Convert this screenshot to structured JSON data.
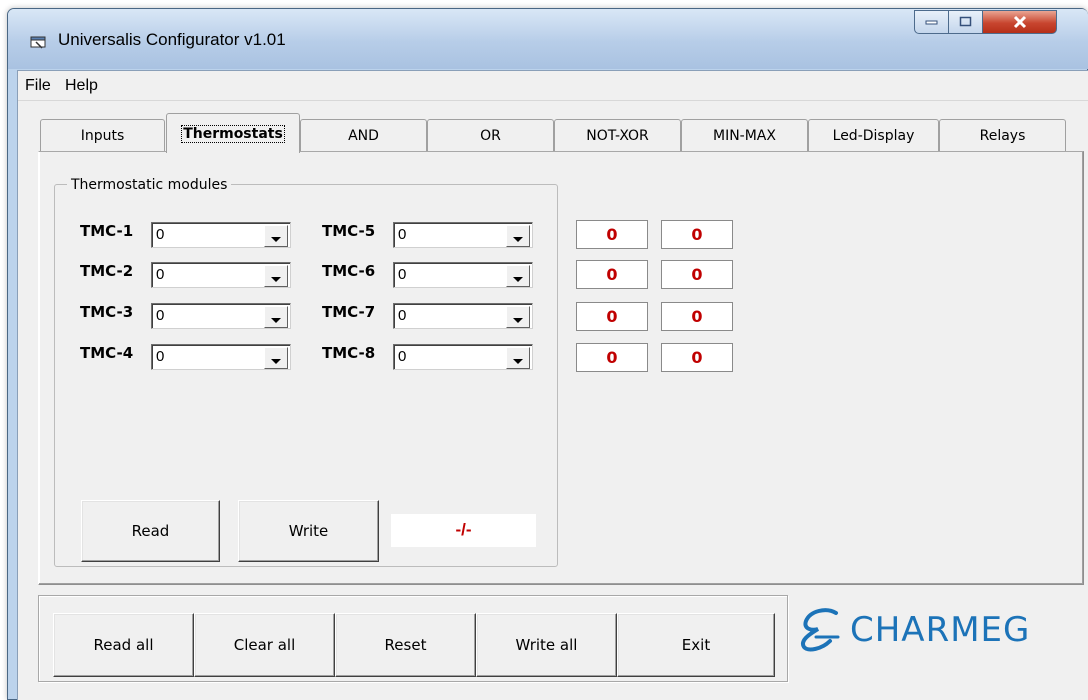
{
  "window": {
    "title": "Universalis Configurator v1.01",
    "controls": [
      "minimize-icon",
      "maximize-icon",
      "close-icon"
    ]
  },
  "menu": [
    "File",
    "Help"
  ],
  "tabs": {
    "items": [
      "Inputs",
      "Thermostats",
      "AND",
      "OR",
      "NOT-XOR",
      "MIN-MAX",
      "Led-Display",
      "Relays"
    ],
    "active": "Thermostats"
  },
  "thermostats": {
    "group_title": "Thermostatic modules",
    "modules": [
      {
        "label": "TMC-1",
        "value": "0"
      },
      {
        "label": "TMC-2",
        "value": "0"
      },
      {
        "label": "TMC-3",
        "value": "0"
      },
      {
        "label": "TMC-4",
        "value": "0"
      },
      {
        "label": "TMC-5",
        "value": "0"
      },
      {
        "label": "TMC-6",
        "value": "0"
      },
      {
        "label": "TMC-7",
        "value": "0"
      },
      {
        "label": "TMC-8",
        "value": "0"
      }
    ],
    "readouts": [
      [
        "0",
        "0"
      ],
      [
        "0",
        "0"
      ],
      [
        "0",
        "0"
      ],
      [
        "0",
        "0"
      ]
    ],
    "read_label": "Read",
    "write_label": "Write",
    "status": "-/-"
  },
  "bottom_buttons": [
    "Read all",
    "Clear all",
    "Reset",
    "Write all",
    "Exit"
  ],
  "logo": {
    "text": "CHARMEG",
    "brand_color": "#1c73b8"
  },
  "colors": {
    "value_red": "#c00000",
    "titlebar": "#b7cde8",
    "close_red": "#c8452f"
  }
}
